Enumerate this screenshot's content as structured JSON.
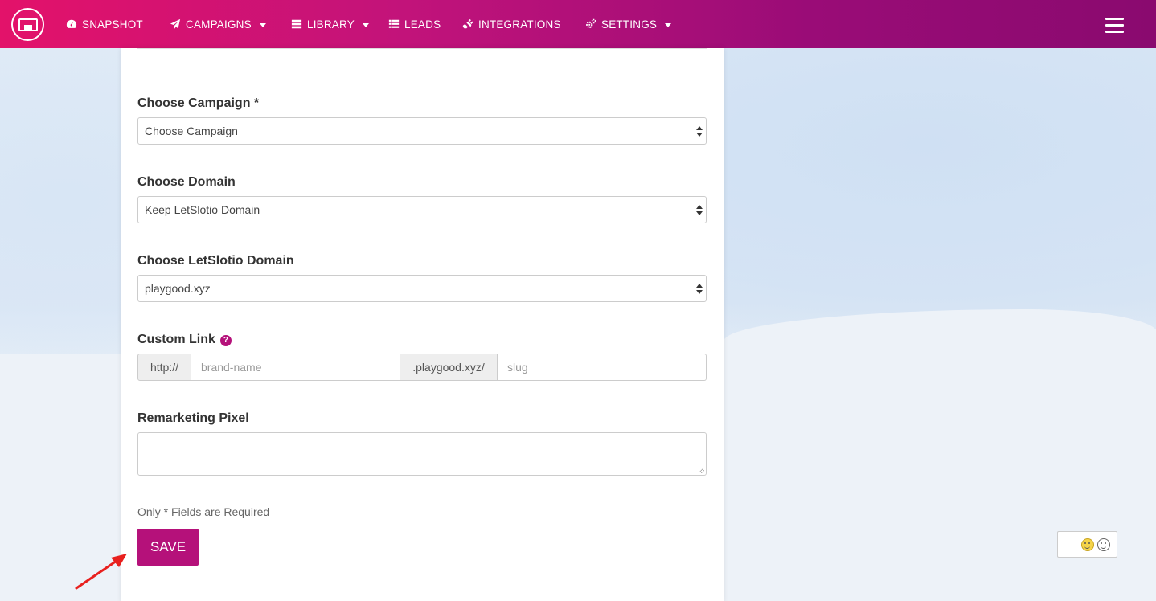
{
  "nav": {
    "items": [
      {
        "label": "SNAPSHOT",
        "icon": "dashboard-icon"
      },
      {
        "label": "CAMPAIGNS",
        "icon": "paper-plane-icon"
      },
      {
        "label": "LIBRARY",
        "icon": "server-icon"
      },
      {
        "label": "LEADS",
        "icon": "list-icon"
      },
      {
        "label": "INTEGRATIONS",
        "icon": "plug-icon"
      },
      {
        "label": "SETTINGS",
        "icon": "cogs-icon"
      }
    ]
  },
  "form": {
    "campaign": {
      "label": "Choose Campaign *",
      "value": "Choose Campaign"
    },
    "domain": {
      "label": "Choose Domain",
      "value": "Keep LetSlotio Domain"
    },
    "letslotio_domain": {
      "label": "Choose LetSlotio Domain",
      "value": "playgood.xyz"
    },
    "custom_link": {
      "label": "Custom Link",
      "help": "?",
      "prefix": "http://",
      "brand_placeholder": "brand-name",
      "middle": ".playgood.xyz/",
      "slug_placeholder": "slug"
    },
    "pixel": {
      "label": "Remarketing Pixel"
    },
    "note": "Only * Fields are Required",
    "save_label": "SAVE"
  },
  "colors": {
    "brand": "#b5117a",
    "nav_start": "#e3126a",
    "nav_end": "#8a0a6f"
  }
}
